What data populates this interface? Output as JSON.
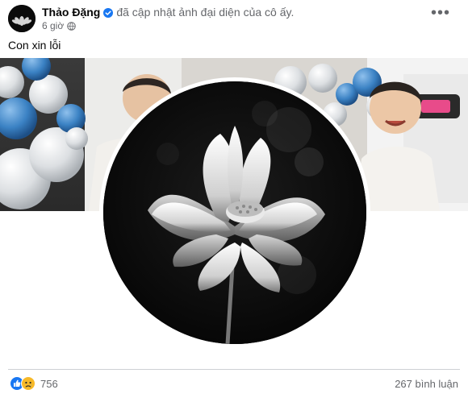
{
  "post": {
    "author": "Thảo Đặng",
    "action_text": "đã cập nhật ảnh đại diện của cô ấy.",
    "time": "6 giờ",
    "caption": "Con xin lỗi",
    "more_icon": "more-horizontal-icon"
  },
  "footer": {
    "reaction_count": "756",
    "comment_count": "267 bình luận",
    "reaction_icons": [
      "like-icon",
      "sad-icon"
    ]
  },
  "colors": {
    "like_blue": "#1877f2",
    "sad_yellow": "#f7b928",
    "secondary_text": "#65676b",
    "divider": "#ced0d4"
  }
}
